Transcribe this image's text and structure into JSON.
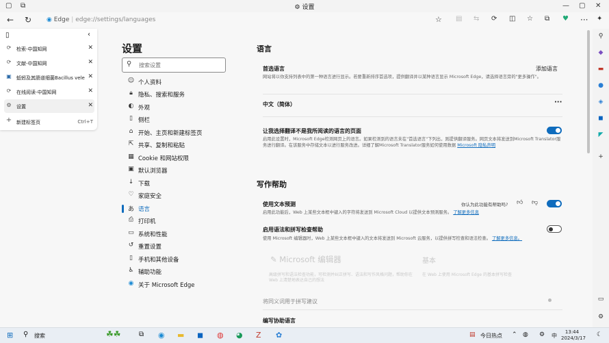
{
  "titlebar": {
    "title": "设置"
  },
  "toolbar": {
    "address_brand": "Edge",
    "address_sep": "|",
    "address_url": "edge://settings/languages"
  },
  "tabs": [
    {
      "label": "检索-中国知网",
      "favicon": "cnki-icon"
    },
    {
      "label": "文献-中国知网",
      "favicon": "cnki-icon"
    },
    {
      "label": "蚯蚓及其肠道细菌Bacillus velez",
      "favicon": "cnki-icon"
    },
    {
      "label": "在线阅读-中国知网",
      "favicon": "cnki-icon"
    },
    {
      "label": "设置",
      "favicon": "gear-icon"
    }
  ],
  "new_tab": {
    "label": "新建标签页",
    "shortcut": "Ctrl+T"
  },
  "nav": {
    "title": "设置",
    "search_placeholder": "搜索设置",
    "items": [
      {
        "label": "个人资料",
        "icon": "person-icon"
      },
      {
        "label": "隐私、搜索和服务",
        "icon": "lock-icon"
      },
      {
        "label": "外观",
        "icon": "appearance-icon"
      },
      {
        "label": "侧栏",
        "icon": "sidebar-icon"
      },
      {
        "label": "开始、主页和新建标签页",
        "icon": "home-icon"
      },
      {
        "label": "共享、复制和粘贴",
        "icon": "share-icon"
      },
      {
        "label": "Cookie 和网站权限",
        "icon": "cookie-icon"
      },
      {
        "label": "默认浏览器",
        "icon": "browser-icon"
      },
      {
        "label": "下载",
        "icon": "download-icon"
      },
      {
        "label": "家庭安全",
        "icon": "family-icon"
      },
      {
        "label": "语言",
        "icon": "language-icon"
      },
      {
        "label": "打印机",
        "icon": "printer-icon"
      },
      {
        "label": "系统和性能",
        "icon": "system-icon"
      },
      {
        "label": "重置设置",
        "icon": "reset-icon"
      },
      {
        "label": "手机和其他设备",
        "icon": "phone-icon"
      },
      {
        "label": "辅助功能",
        "icon": "accessibility-icon"
      },
      {
        "label": "关于 Microsoft Edge",
        "icon": "edge-icon"
      }
    ]
  },
  "main": {
    "lang_title": "语言",
    "preferred_title": "首选语言",
    "add_lang": "添加语言",
    "preferred_desc": "网站将以你支持列表中的第一种语言进行显示。若要重新排序首选项，提供翻译并以某种语言显示 Microsoft Edge，请选择语言旁的\"更多操作\"。",
    "lang_item": "中文（简体）",
    "more": "···",
    "translate_title": "让我选择翻译不是我所阅读的语言的页面",
    "translate_desc": "启用此设置时，Microsoft Edge检测网页上的语言。如果检测到的语言未在\"首选语言\"下列出，则提供翻译服务。网页文本将发送到Microsoft Translator服务进行翻译。在该服务中存储文本以进行服务改进。详细了解Microsoft Translator服务如何使用数据",
    "translate_link": "Microsoft 隐私声明",
    "writing_title": "写作帮助",
    "predict_title": "使用文本预测",
    "predict_question": "你认为此功能有帮助吗?",
    "predict_desc": "启用此功能后，Web 上某些文本框中键入的字符将发送到 Microsoft Cloud 以提供文本预测服务。",
    "predict_link": "了解更多信息",
    "grammar_title": "启用语法和拼写检查帮助",
    "grammar_desc": "使用 Microsoft 编辑器时，Web 上某些文本框中键入的文本将发送到 Microsoft 云服务，以提供拼写检查和语法检查。",
    "grammar_link": "了解更多信息。",
    "editor_title": "Microsoft 编辑器",
    "editor_desc": "高级拼写和语法检查功能，可检测并纠正拼写、语法和写作风格问题，帮助你在 Web 上清楚地表达自己的想法",
    "basic_title": "基本",
    "basic_desc": "在 Web 上使用 Microsoft Edge 的基本拼写检查",
    "synonym": "将同义词用于拼写建议",
    "writing_lang": "编写协助语言"
  },
  "taskbar": {
    "search": "搜索",
    "widget": "今日热点",
    "ime": "中",
    "time": "13:44",
    "date": "2024/3/17"
  }
}
